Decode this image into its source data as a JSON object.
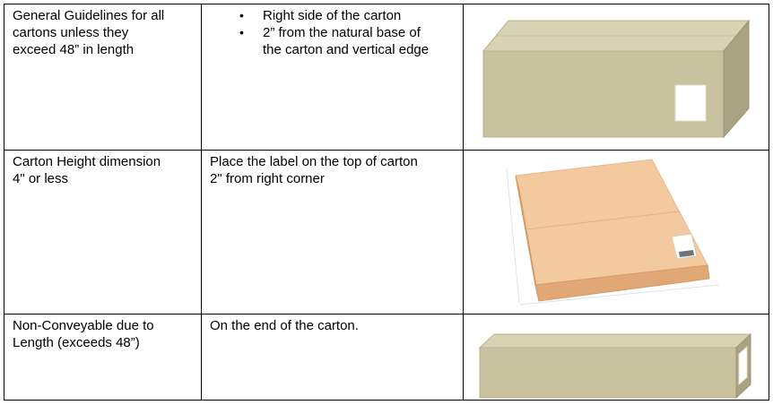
{
  "rows": [
    {
      "condition_lines": [
        "General Guidelines for all",
        "cartons unless they",
        "exceed 48” in length"
      ],
      "placement_bullets": [
        [
          "Right side of the carton"
        ],
        [
          "2” from the natural base of",
          "the carton and vertical edge"
        ]
      ],
      "image": "carton-side-label"
    },
    {
      "condition_lines": [
        "Carton Height dimension",
        "4\" or less"
      ],
      "placement_lines": [
        "Place the label on the top of carton",
        "2\" from right corner"
      ],
      "image": "flat-carton-top-label"
    },
    {
      "condition_lines": [
        "Non-Conveyable due to",
        "Length (exceeds 48”)"
      ],
      "placement_lines": [
        "On the end of the carton."
      ],
      "image": "long-carton-end-label"
    }
  ],
  "bullet_glyph": "•",
  "colors": {
    "carton_front": "#c9c29e",
    "carton_top": "#d9d3b5",
    "carton_side": "#a9a283",
    "flat_carton_top": "#f3c9a0",
    "flat_carton_side": "#e0a877",
    "label": "#ffffff",
    "grid": "#000000"
  }
}
